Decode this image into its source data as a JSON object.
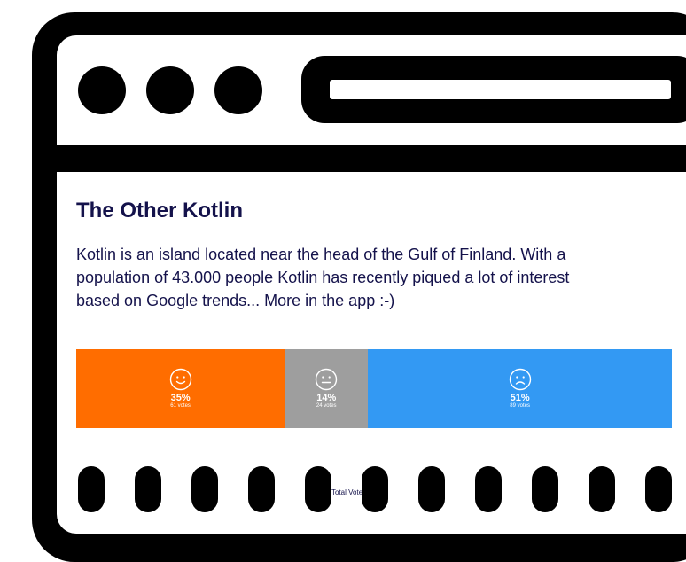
{
  "article": {
    "title": "The Other Kotlin",
    "description": "Kotlin is an island located near the head of the Gulf of Finland. With a population of 43.000 people Kotlin has recently piqued a lot of interest based on Google trends... More in the app :-)"
  },
  "poll": {
    "total_label": "Total Votes",
    "options": [
      {
        "icon": "smile-icon",
        "percent": "35%",
        "votes": "61 votes",
        "share": 35,
        "color": "#ff6d00"
      },
      {
        "icon": "neutral-face-icon",
        "percent": "14%",
        "votes": "24 votes",
        "share": 14,
        "color": "#9e9e9e"
      },
      {
        "icon": "frown-icon",
        "percent": "51%",
        "votes": "89 votes",
        "share": 51,
        "color": "#3399f3"
      }
    ]
  },
  "colors": {
    "frame": "#000000",
    "heading_text": "#14124b"
  }
}
